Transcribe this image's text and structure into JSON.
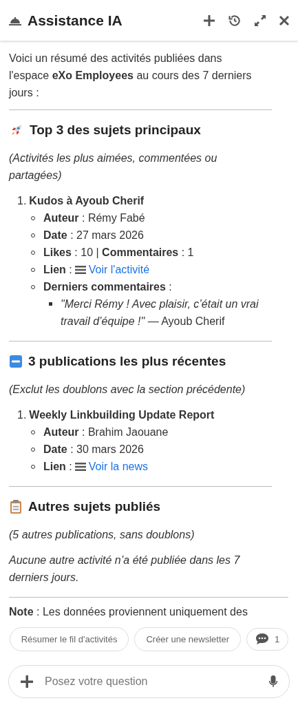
{
  "header": {
    "title": "Assistance IA"
  },
  "intro": "Voici un résumé des activités publiées dans l'espace **eXo Employees** au cours des 7 derniers jours :",
  "sections": [
    {
      "heading": "Top 3 des sujets principaux",
      "subtitle": "(Activités les plus aimées, commentées ou partagées)",
      "items": [
        {
          "number": "1.",
          "title": "Kudos à Ayoub Cherif",
          "details": [
            {
              "kind": "text",
              "text": "**Auteur** : Rémy Fabé"
            },
            {
              "kind": "text",
              "text": "**Date** : 27 mars 2026"
            },
            {
              "kind": "text",
              "text": "**Likes** : 10 | **Commentaires** : 1"
            },
            {
              "kind": "link",
              "label": "**Lien** :",
              "link": "Voir l'activité"
            },
            {
              "kind": "comments",
              "text": "**Derniers commentaires** :",
              "comments": [
                "*\"Merci Rémy ! Avec plaisir, c’était un vrai travail d’équipe !\"* — Ayoub Cherif"
              ]
            }
          ]
        }
      ]
    },
    {
      "heading": "3 publications les plus récentes",
      "subtitle": "(Exclut les doublons avec la section précédente)",
      "items": [
        {
          "number": "1.",
          "title": "Weekly Linkbuilding Update Report",
          "details": [
            {
              "kind": "text",
              "text": "**Auteur** : Brahim Jaouane"
            },
            {
              "kind": "text",
              "text": "**Date** : 30 mars 2026"
            },
            {
              "kind": "link",
              "label": "**Lien** :",
              "link": "Voir la news"
            }
          ]
        }
      ]
    },
    {
      "heading": "Autres sujets publiés",
      "subtitle": "(5 autres publications, sans doublons)",
      "paragraphs": [
        "Aucune autre activité n’a été publiée dans les 7 derniers jours."
      ]
    }
  ],
  "note": "**Note** : Les données proviennent uniquement des",
  "suggestions": [
    "Résumer le fil d'activités",
    "Créer une newsletter"
  ],
  "comment_count": "1",
  "input": {
    "placeholder": "Posez votre question"
  }
}
